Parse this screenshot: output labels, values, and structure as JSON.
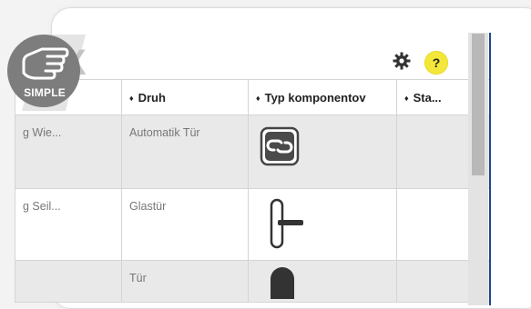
{
  "badge": {
    "label": "SIMPLE"
  },
  "toolbar": {
    "help_label": "?"
  },
  "table": {
    "headers": [
      "",
      "Druh",
      "Typ komponentov",
      "Sta..."
    ],
    "rows": [
      {
        "name": "g Wie...",
        "druh": "Automatik Tür",
        "typ_icon": "link-chain-icon",
        "status": ""
      },
      {
        "name": "g Seil...",
        "druh": "Glastür",
        "typ_icon": "door-handle-icon",
        "status": ""
      },
      {
        "name": "",
        "druh": "Tür",
        "typ_icon": "door-knob-icon",
        "status": ""
      }
    ]
  },
  "colors": {
    "help_badge": "#f3e73a",
    "badge_bg": "#7d7d7d",
    "row_shade": "#e9e9e9"
  }
}
